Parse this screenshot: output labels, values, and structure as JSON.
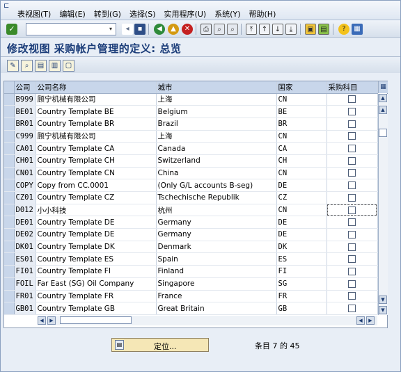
{
  "menu": {
    "items": [
      "表视图(T)",
      "编辑(E)",
      "转到(G)",
      "选择(S)",
      "实用程序(U)",
      "系统(Y)",
      "帮助(H)"
    ]
  },
  "toolbar": {
    "command_value": "",
    "icons": [
      "enter-icon",
      "back-icon",
      "exit-icon",
      "cancel-icon",
      "print-icon",
      "find-icon",
      "find-next-icon",
      "first-page-icon",
      "previous-page-icon",
      "next-page-icon",
      "last-page-icon",
      "new-session-icon",
      "shortcut-icon",
      "help-icon",
      "layout-icon"
    ]
  },
  "page": {
    "title": "修改视图 采购帐户管理的定义: 总览"
  },
  "app_toolbar": {
    "icons": [
      "change-display-icon",
      "details-icon",
      "select-all-icon",
      "select-block-icon",
      "deselect-all-icon"
    ]
  },
  "table": {
    "headers": [
      "公司",
      "公司名称",
      "城市",
      "国家",
      "采购科目"
    ],
    "rows": [
      {
        "code": "B999",
        "name": "顾宁机械有限公司",
        "city": "上海",
        "country": "CN",
        "purch": false
      },
      {
        "code": "BE01",
        "name": "Country Template BE",
        "city": "Belgium",
        "country": "BE",
        "purch": false
      },
      {
        "code": "BR01",
        "name": "Country Template BR",
        "city": "Brazil",
        "country": "BR",
        "purch": false
      },
      {
        "code": "C999",
        "name": "顾宁机械有限公司",
        "city": "上海",
        "country": "CN",
        "purch": false
      },
      {
        "code": "CA01",
        "name": "Country Template CA",
        "city": "Canada",
        "country": "CA",
        "purch": false
      },
      {
        "code": "CH01",
        "name": "Country Template CH",
        "city": "Switzerland",
        "country": "CH",
        "purch": false
      },
      {
        "code": "CN01",
        "name": "Country Template CN",
        "city": "China",
        "country": "CN",
        "purch": false
      },
      {
        "code": "COPY",
        "name": "Copy from CC.0001",
        "city": "(Only G/L accounts B-seg)",
        "country": "DE",
        "purch": false
      },
      {
        "code": "CZ01",
        "name": "Country Template CZ",
        "city": "Tschechische Republik",
        "country": "CZ",
        "purch": false
      },
      {
        "code": "D012",
        "name": "小小科技",
        "city": "杭州",
        "country": "CN",
        "purch": false
      },
      {
        "code": "DE01",
        "name": "Country Template DE",
        "city": "Germany",
        "country": "DE",
        "purch": false
      },
      {
        "code": "DE02",
        "name": "Country Template DE",
        "city": "Germany",
        "country": "DE",
        "purch": false
      },
      {
        "code": "DK01",
        "name": "Country Template DK",
        "city": "Denmark",
        "country": "DK",
        "purch": false
      },
      {
        "code": "ES01",
        "name": "Country Template ES",
        "city": "Spain",
        "country": "ES",
        "purch": false
      },
      {
        "code": "FI01",
        "name": "Country Template FI",
        "city": "Finland",
        "country": "FI",
        "purch": false
      },
      {
        "code": "FOIL",
        "name": "Far East (SG) Oil Company",
        "city": "Singapore",
        "country": "SG",
        "purch": false
      },
      {
        "code": "FR01",
        "name": "Country Template FR",
        "city": "France",
        "country": "FR",
        "purch": false
      },
      {
        "code": "GB01",
        "name": "Country Template GB",
        "city": "Great Britain",
        "country": "GB",
        "purch": false
      }
    ]
  },
  "footer": {
    "position_button": "定位...",
    "entry_info": "条目 7 的 45"
  }
}
